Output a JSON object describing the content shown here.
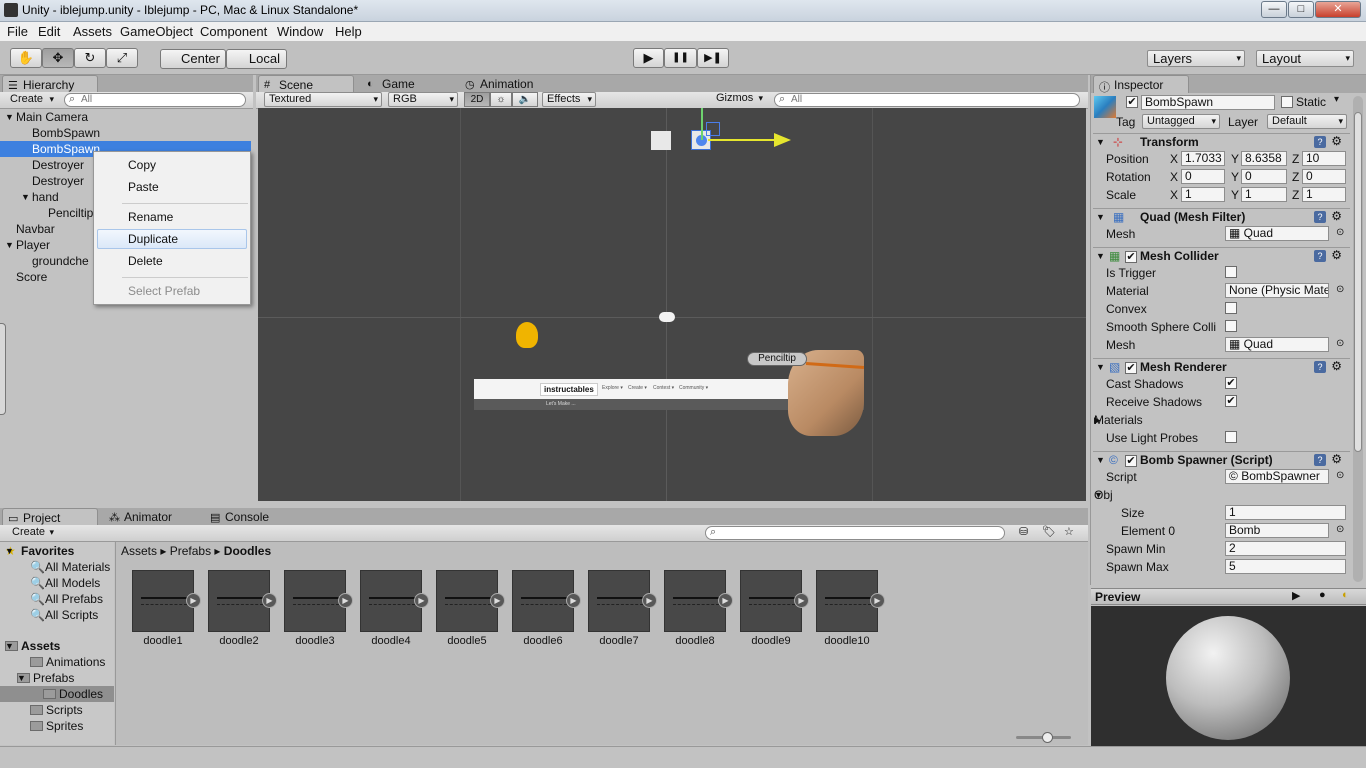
{
  "window": {
    "title": "Unity - iblejump.unity - Iblejump - PC, Mac & Linux Standalone*",
    "min": "—",
    "max": "□",
    "close": "✕"
  },
  "menu": [
    "File",
    "Edit",
    "Assets",
    "GameObject",
    "Component",
    "Window",
    "Help"
  ],
  "toolbar": {
    "hand": "✋",
    "move": "✥",
    "rotate": "↻",
    "scale": "⤢",
    "center": "Center",
    "local": "Local",
    "play": "▶",
    "pause": "❚❚",
    "step": "▶❚",
    "layers": "Layers",
    "layout": "Layout"
  },
  "hierarchy": {
    "tab": "Hierarchy",
    "create": "Create",
    "search": "All",
    "items": [
      "Main Camera",
      "BombSpawn",
      "BombSpawn",
      "Destroyer",
      "Destroyer",
      "hand",
      "Penciltip",
      "Navbar",
      "Player",
      "groundche",
      "Score"
    ]
  },
  "context_menu": {
    "copy": "Copy",
    "paste": "Paste",
    "rename": "Rename",
    "duplicate": "Duplicate",
    "delete": "Delete",
    "select_prefab": "Select Prefab"
  },
  "scene": {
    "tabs": [
      "Scene",
      "Game",
      "Animation"
    ],
    "shading": "Textured",
    "render": "RGB",
    "mode2d": "2D",
    "effects": "Effects",
    "gizmos": "Gizmos",
    "search": "All",
    "penciltip_label": "Penciltip",
    "navbar_logo": "instructables",
    "navbar_menu": [
      "Explore ▾",
      "Create ▾",
      "Contest ▾",
      "Community ▾"
    ],
    "navbar_sub": "Let's Make ..."
  },
  "project": {
    "tabs": [
      "Project",
      "Animator",
      "Console"
    ],
    "create": "Create",
    "favorites_label": "Favorites",
    "favorites": [
      "All Materials",
      "All Models",
      "All Prefabs",
      "All Scripts"
    ],
    "assets_label": "Assets",
    "folders": [
      "Animations",
      "Prefabs",
      "Doodles",
      "Scripts",
      "Sprites"
    ],
    "breadcrumb": [
      "Assets",
      "Prefabs",
      "Doodles"
    ],
    "doodles": [
      "doodle1",
      "doodle2",
      "doodle3",
      "doodle4",
      "doodle5",
      "doodle6",
      "doodle7",
      "doodle8",
      "doodle9",
      "doodle10"
    ]
  },
  "inspector": {
    "tab": "Inspector",
    "name": "BombSpawn",
    "static": "Static",
    "tag_label": "Tag",
    "tag": "Untagged",
    "layer_label": "Layer",
    "layer": "Default",
    "transform": {
      "title": "Transform",
      "position": {
        "label": "Position",
        "x": "1.7033",
        "y": "8.6358",
        "z": "10"
      },
      "rotation": {
        "label": "Rotation",
        "x": "0",
        "y": "0",
        "z": "0"
      },
      "scale": {
        "label": "Scale",
        "x": "1",
        "y": "1",
        "z": "1"
      }
    },
    "mesh_filter": {
      "title": "Quad (Mesh Filter)",
      "mesh_label": "Mesh",
      "mesh": "Quad"
    },
    "mesh_collider": {
      "title": "Mesh Collider",
      "is_trigger": "Is Trigger",
      "material_label": "Material",
      "material": "None (Physic Mate",
      "convex": "Convex",
      "smooth": "Smooth Sphere Colli",
      "mesh_label": "Mesh",
      "mesh": "Quad"
    },
    "mesh_renderer": {
      "title": "Mesh Renderer",
      "cast": "Cast Shadows",
      "receive": "Receive Shadows",
      "materials": "Materials",
      "probes": "Use Light Probes"
    },
    "script": {
      "title": "Bomb Spawner (Script)",
      "script_label": "Script",
      "script": "BombSpawner",
      "obj": "Obj",
      "size_label": "Size",
      "size": "1",
      "element_label": "Element 0",
      "element": "Bomb",
      "spawn_min_label": "Spawn Min",
      "spawn_min": "2",
      "spawn_max_label": "Spawn Max",
      "spawn_max": "5"
    },
    "preview": "Preview"
  },
  "axis": {
    "x": "X",
    "y": "Y",
    "z": "Z"
  }
}
